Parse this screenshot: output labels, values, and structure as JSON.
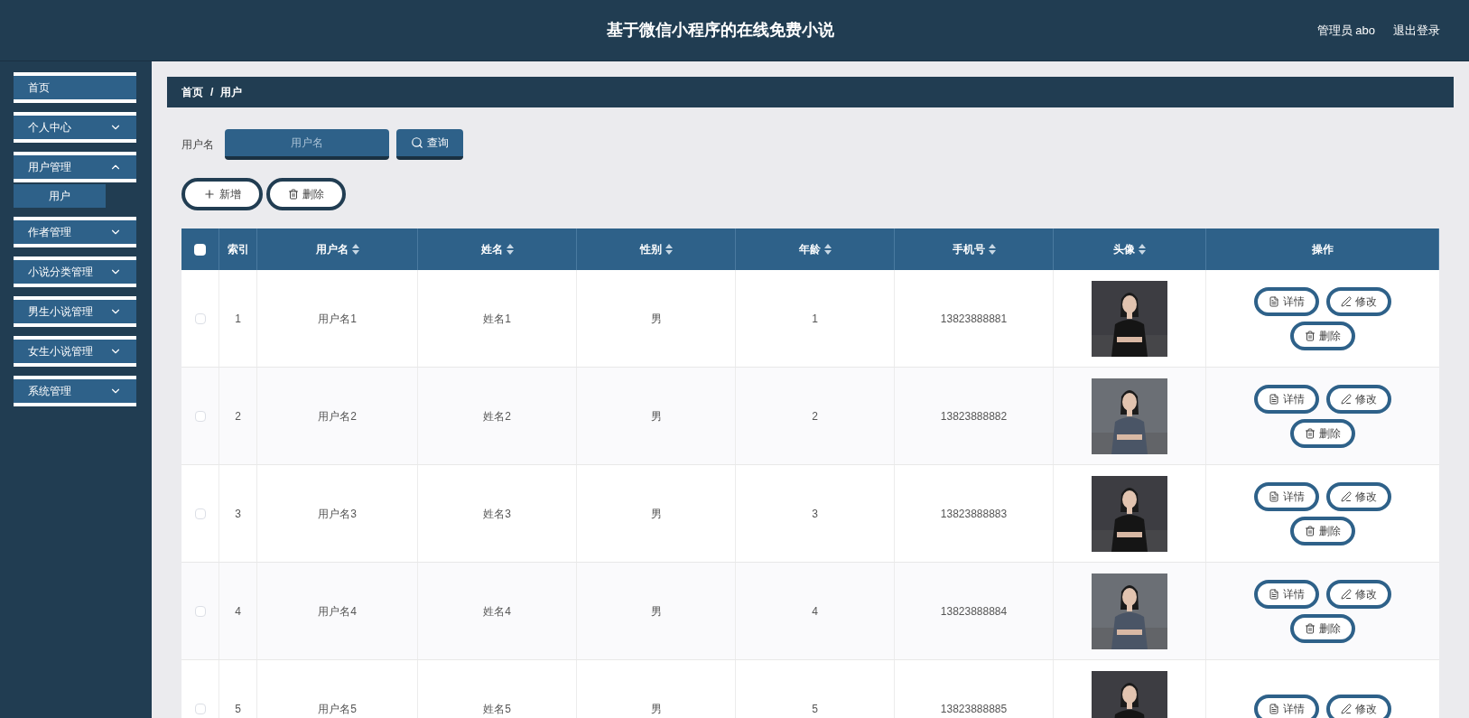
{
  "header": {
    "title": "基于微信小程序的在线免费小说",
    "user": "管理员 abo",
    "logout": "退出登录"
  },
  "sidebar": {
    "items": [
      {
        "label": "首页",
        "kind": "link"
      },
      {
        "label": "个人中心",
        "kind": "menu",
        "expanded": false
      },
      {
        "label": "用户管理",
        "kind": "menu",
        "expanded": true,
        "children": [
          {
            "label": "用户",
            "selected": true
          }
        ]
      },
      {
        "label": "作者管理",
        "kind": "menu",
        "expanded": false
      },
      {
        "label": "小说分类管理",
        "kind": "menu",
        "expanded": false
      },
      {
        "label": "男生小说管理",
        "kind": "menu",
        "expanded": false
      },
      {
        "label": "女生小说管理",
        "kind": "menu",
        "expanded": false
      },
      {
        "label": "系统管理",
        "kind": "menu",
        "expanded": false
      }
    ]
  },
  "breadcrumb": [
    "首页",
    "/",
    "用户"
  ],
  "search": {
    "label": "用户名",
    "placeholder": "用户名",
    "button": "查询"
  },
  "toolbar": [
    {
      "label": "新增",
      "kind": "add"
    },
    {
      "label": "删除",
      "kind": "delete"
    }
  ],
  "table": {
    "columns": [
      {
        "label": "索引",
        "sortable": false
      },
      {
        "label": "用户名",
        "sortable": true
      },
      {
        "label": "姓名",
        "sortable": true
      },
      {
        "label": "性别",
        "sortable": true
      },
      {
        "label": "年龄",
        "sortable": true
      },
      {
        "label": "手机号",
        "sortable": true
      },
      {
        "label": "头像",
        "sortable": true
      },
      {
        "label": "操作",
        "sortable": false
      }
    ],
    "select_all": {
      "checked": false
    },
    "rows": [
      {
        "checked": false,
        "cells": [
          "1",
          "用户名1",
          "姓名1",
          "男",
          "1",
          "13823888881"
        ],
        "avatar": {
          "kind": "picture"
        },
        "actions": [
          {
            "label": "详情",
            "kind": "detail"
          },
          {
            "label": "修改",
            "kind": "edit"
          },
          {
            "label": "删除",
            "kind": "delete"
          }
        ]
      },
      {
        "checked": false,
        "cells": [
          "2",
          "用户名2",
          "姓名2",
          "男",
          "2",
          "13823888882"
        ],
        "avatar": {
          "kind": "picture"
        },
        "actions": [
          {
            "label": "详情",
            "kind": "detail"
          },
          {
            "label": "修改",
            "kind": "edit"
          },
          {
            "label": "删除",
            "kind": "delete"
          }
        ]
      },
      {
        "checked": false,
        "cells": [
          "3",
          "用户名3",
          "姓名3",
          "男",
          "3",
          "13823888883"
        ],
        "avatar": {
          "kind": "picture"
        },
        "actions": [
          {
            "label": "详情",
            "kind": "detail"
          },
          {
            "label": "修改",
            "kind": "edit"
          },
          {
            "label": "删除",
            "kind": "delete"
          }
        ]
      },
      {
        "checked": false,
        "cells": [
          "4",
          "用户名4",
          "姓名4",
          "男",
          "4",
          "13823888884"
        ],
        "avatar": {
          "kind": "picture"
        },
        "actions": [
          {
            "label": "详情",
            "kind": "detail"
          },
          {
            "label": "修改",
            "kind": "edit"
          },
          {
            "label": "删除",
            "kind": "delete"
          }
        ]
      },
      {
        "checked": false,
        "cells": [
          "5",
          "用户名5",
          "姓名5",
          "男",
          "5",
          "13823888885"
        ],
        "avatar": {
          "kind": "picture"
        },
        "actions": [
          {
            "label": "详情",
            "kind": "detail"
          },
          {
            "label": "修改",
            "kind": "edit"
          }
        ]
      }
    ]
  }
}
